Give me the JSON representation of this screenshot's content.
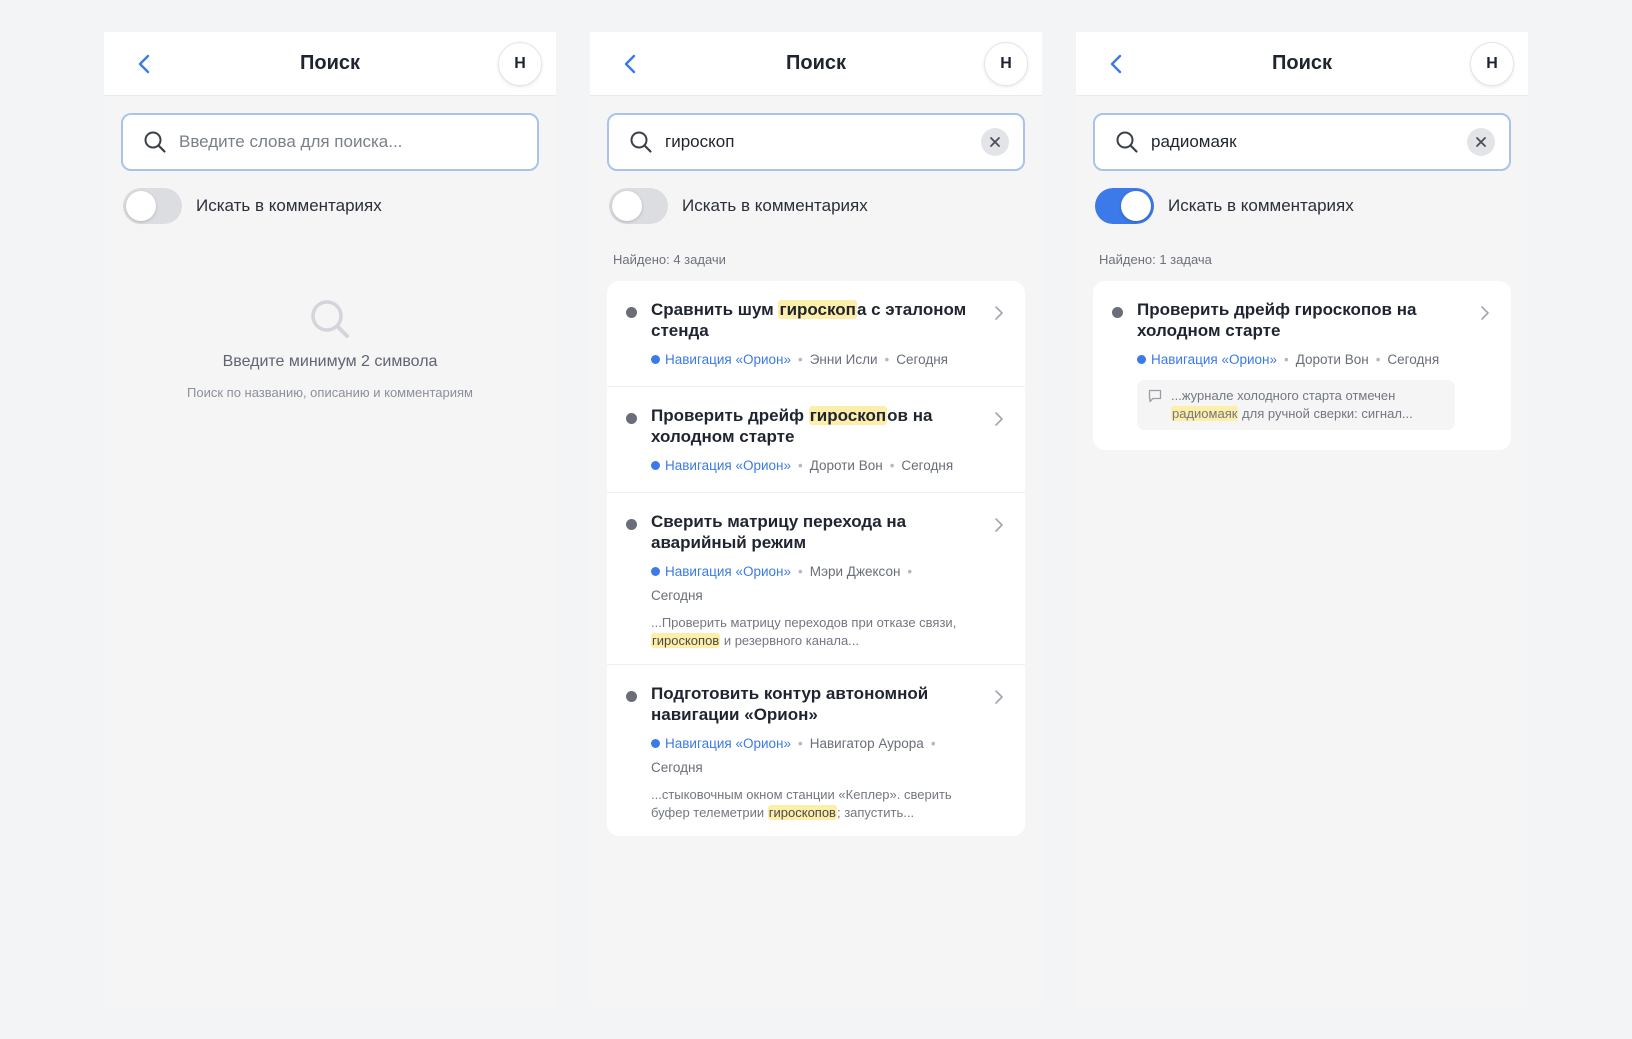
{
  "screens": [
    {
      "title": "Поиск",
      "avatar": "Н",
      "search": {
        "value": "",
        "placeholder": "Введите слова для поиска..."
      },
      "toggle": {
        "label": "Искать в комментариях",
        "on": false
      },
      "empty": {
        "title": "Введите минимум 2 символа",
        "subtitle": "Поиск по названию, описанию и комментариям"
      }
    },
    {
      "title": "Поиск",
      "avatar": "Н",
      "search": {
        "value": "гироскоп",
        "placeholder": "Введите слова для поиска..."
      },
      "toggle": {
        "label": "Искать в комментариях",
        "on": false
      },
      "found": "Найдено: 4 задачи",
      "results": [
        {
          "title_pre": "Сравнить шум ",
          "title_hl": "гироскоп",
          "title_post": "а с эталоном стенда",
          "project": "Навигация «Орион»",
          "author": "Энни Исли",
          "date": "Сегодня"
        },
        {
          "title_pre": "Проверить дрейф ",
          "title_hl": "гироскоп",
          "title_post": "ов на холодном старте",
          "project": "Навигация «Орион»",
          "author": "Дороти Вон",
          "date": "Сегодня"
        },
        {
          "title": "Сверить матрицу перехода на аварийный режим",
          "project": "Навигация «Орион»",
          "author": "Мэри Джексон",
          "date": "Сегодня",
          "snippet_pre": "...Проверить матрицу переходов при отказе связи, ",
          "snippet_hl": "гироскопов",
          "snippet_post": " и резервного канала..."
        },
        {
          "title": "Подготовить контур автономной навигации «Орион»",
          "project": "Навигация «Орион»",
          "author": "Навигатор Аурора",
          "date": "Сегодня",
          "snippet_pre": "...стыковочным окном станции «Кеплер». сверить буфер телеметрии ",
          "snippet_hl": "гироскопов",
          "snippet_post": "; запустить..."
        }
      ]
    },
    {
      "title": "Поиск",
      "avatar": "Н",
      "search": {
        "value": "радиомаяк",
        "placeholder": "Введите слова для поиска..."
      },
      "toggle": {
        "label": "Искать в комментариях",
        "on": true
      },
      "found": "Найдено: 1 задача",
      "results": [
        {
          "title": "Проверить дрейф гироскопов на холодном старте",
          "project": "Навигация «Орион»",
          "author": "Дороти Вон",
          "date": "Сегодня",
          "comment_pre": "...журнале холодного старта отмечен ",
          "comment_hl": "радиомаяк",
          "comment_post": " для ручной сверки: сигнал..."
        }
      ]
    }
  ],
  "colors": {
    "accent": "#3b7ae8",
    "highlight": "#fdeeaa",
    "search_border": "#a9c3ea"
  },
  "icons": [
    "chevron-left-icon",
    "search-icon",
    "clear-icon",
    "chevron-right-icon",
    "comment-icon",
    "status-dot-icon"
  ]
}
